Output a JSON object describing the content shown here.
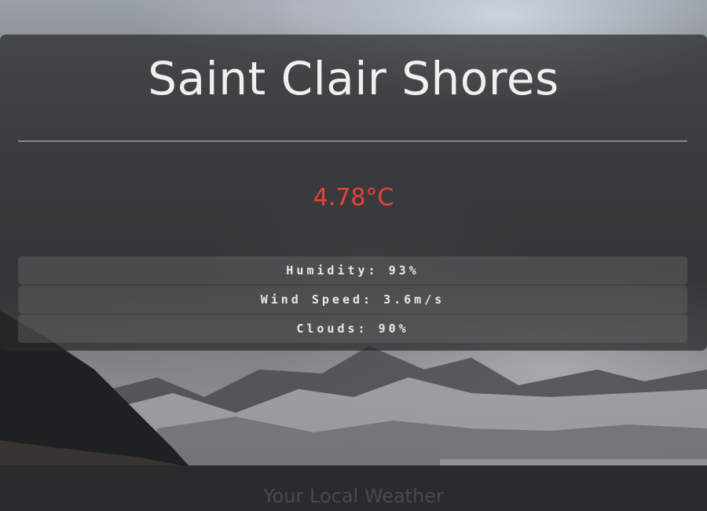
{
  "weather": {
    "city": "Saint Clair Shores",
    "temperature": "4.78°C",
    "stats": [
      {
        "label": "Humidity: 93%"
      },
      {
        "label": "Wind Speed: 3.6m/s"
      },
      {
        "label": "Clouds: 90%"
      }
    ]
  },
  "footer": {
    "title": "Your Local Weather"
  },
  "colors": {
    "temperature": "#e8413d",
    "card_background": "rgba(40,40,40,0.72)",
    "footer_background": "#2b2a2c"
  }
}
